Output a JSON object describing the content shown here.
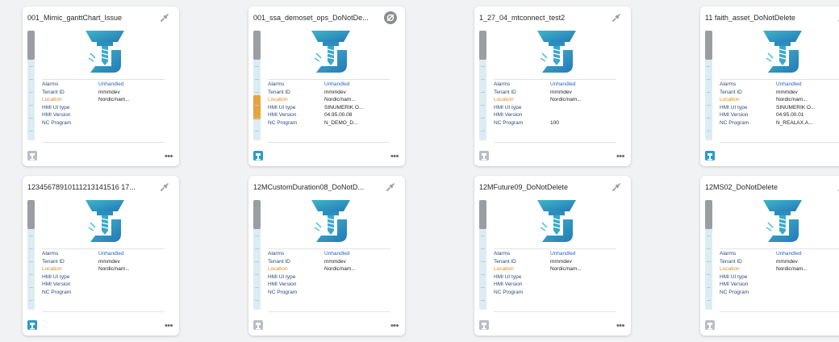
{
  "colors": {
    "accent": "#2a9cc7",
    "orange": "#e8a33b",
    "unhandled": "#2a63c6"
  },
  "labels": {
    "alarms": "Alarms",
    "tenant": "Tenant ID",
    "location": "Location",
    "hmi_type": "HMI UI type",
    "hmi_version": "HMI Version",
    "nc_program": "NC Program"
  },
  "cards": [
    {
      "title": "001_Mimic_ganttChart_Issue",
      "conn_icon": "plug-disconnected-icon",
      "alarm": "Unhandled",
      "tenant": "mmmdev",
      "location": "Nordic/nam...",
      "hmi_type": "",
      "hmi_version": "",
      "nc_program": "",
      "foot_active": false,
      "orange": false
    },
    {
      "title": "001_ssa_demoset_ops_DoNotDe...",
      "conn_icon": "link-off-icon",
      "alarm": "Unhandled",
      "tenant": "mmmdev",
      "location": "Nordic/nam...",
      "hmi_type": "SINUMERIK O...",
      "hmi_version": "04.95.00.08",
      "nc_program": "N_DEMO_D...",
      "foot_active": true,
      "orange": true
    },
    {
      "title": "1_27_04_mtconnect_test2",
      "conn_icon": "plug-disconnected-icon",
      "alarm": "Unhandled",
      "tenant": "mmmdev",
      "location": "Nordic/nam...",
      "hmi_type": "",
      "hmi_version": "",
      "nc_program": "100",
      "foot_active": false,
      "orange": false
    },
    {
      "title": "11 faith_asset_DoNotDelete",
      "conn_icon": "plug-disconnected-icon",
      "alarm": "Unhandled",
      "tenant": "mmmdev",
      "location": "Nordic/nam...",
      "hmi_type": "SINUMERIK O...",
      "hmi_version": "04.95.00.01",
      "nc_program": "N_REALAX.A...",
      "foot_active": true,
      "orange": false
    },
    {
      "title": "12345678910111213141516 17...",
      "conn_icon": "plug-disconnected-icon",
      "alarm": "Unhandled",
      "tenant": "mmmdev",
      "location": "Nordic/nam...",
      "hmi_type": "",
      "hmi_version": "",
      "nc_program": "",
      "foot_active": true,
      "orange": false
    },
    {
      "title": "12MCustomDuration08_DoNotD...",
      "conn_icon": "plug-disconnected-icon",
      "alarm": "Unhandled",
      "tenant": "mmmdev",
      "location": "Nordic/nam...",
      "hmi_type": "",
      "hmi_version": "",
      "nc_program": "",
      "foot_active": false,
      "orange": false
    },
    {
      "title": "12MFuture09_DoNotDelete",
      "conn_icon": "plug-disconnected-icon",
      "alarm": "Unhandled",
      "tenant": "mmmdev",
      "location": "Nordic/nam...",
      "hmi_type": "",
      "hmi_version": "",
      "nc_program": "",
      "foot_active": false,
      "orange": false
    },
    {
      "title": "12MS02_DoNotDelete",
      "conn_icon": "plug-disconnected-icon",
      "alarm": "Unhandled",
      "tenant": "mmmdev",
      "location": "Nordic/nam...",
      "hmi_type": "",
      "hmi_version": "",
      "nc_program": "",
      "foot_active": false,
      "orange": false
    }
  ]
}
